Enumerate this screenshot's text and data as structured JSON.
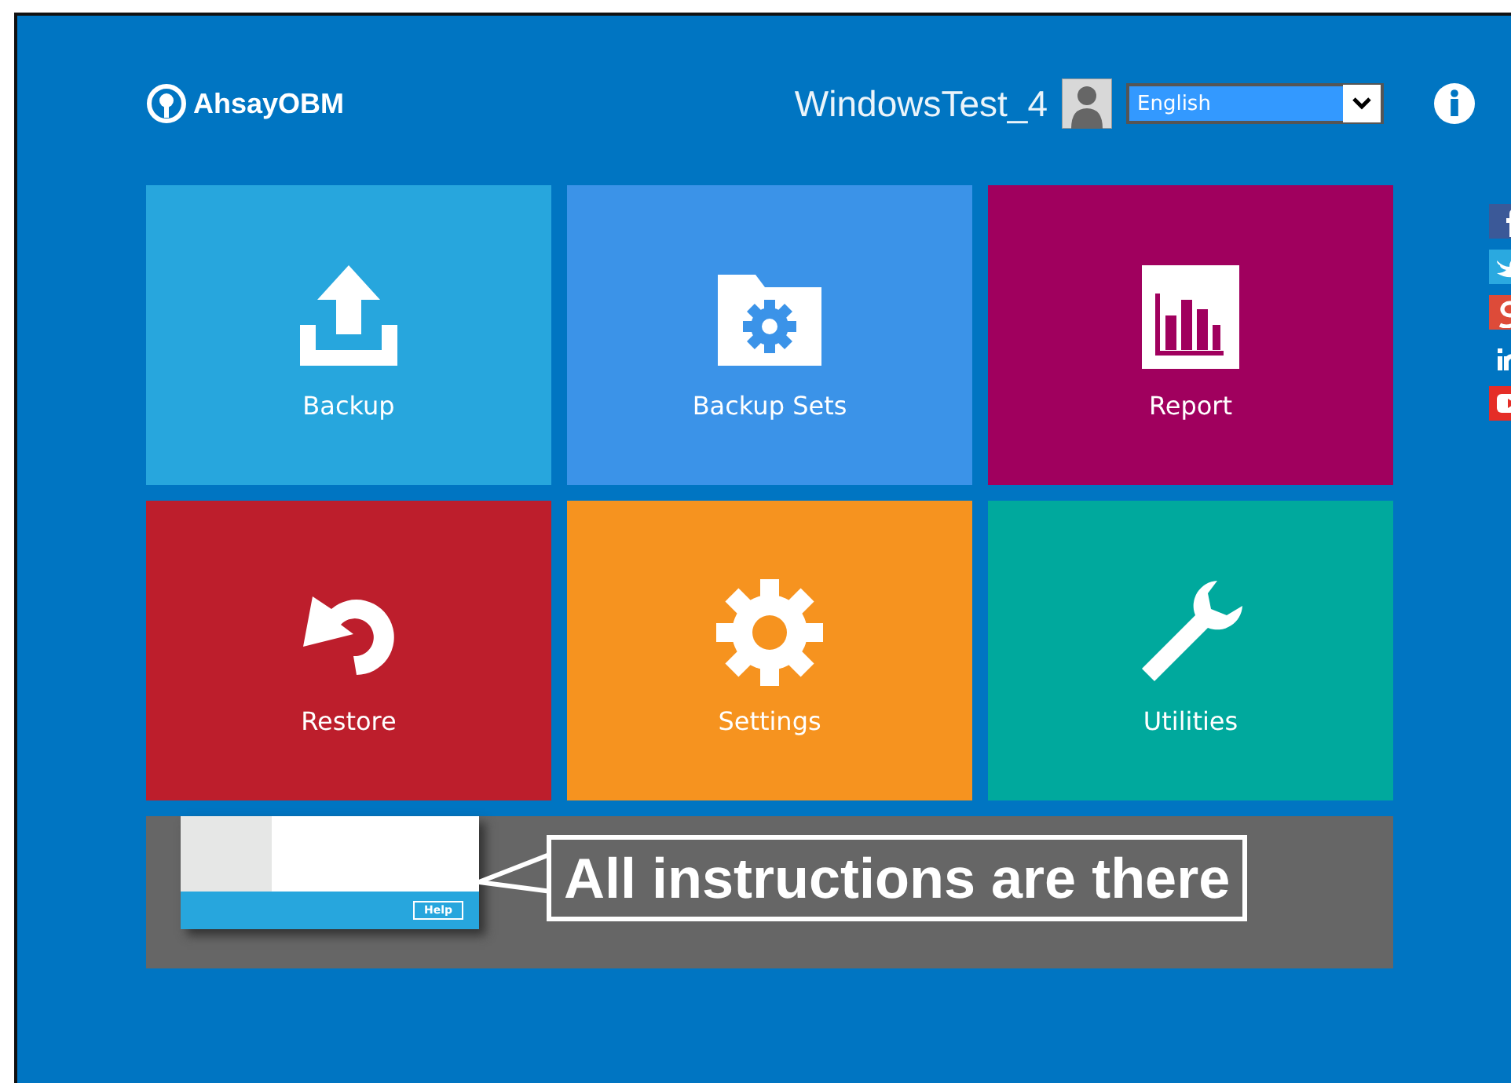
{
  "header": {
    "logo": "AhsayOBM",
    "user": "WindowsTest_4",
    "language": "English"
  },
  "tiles": [
    {
      "label": "Backup",
      "kind": "upload",
      "color": "#27a6dd"
    },
    {
      "label": "Backup Sets",
      "kind": "folder",
      "color": "#3b93e8"
    },
    {
      "label": "Report",
      "kind": "report",
      "color": "#a0005e"
    },
    {
      "label": "Restore",
      "kind": "restore",
      "color": "#bd1e2c"
    },
    {
      "label": "Settings",
      "kind": "gear",
      "color": "#f6931f"
    },
    {
      "label": "Utilities",
      "kind": "wrench",
      "color": "#00a99d"
    }
  ],
  "banner": {
    "help_button": "Help",
    "caption": "All instructions are there"
  },
  "social": [
    {
      "kind": "facebook",
      "color": "#3b5998"
    },
    {
      "kind": "twitter",
      "color": "#2aa9e0"
    },
    {
      "kind": "google",
      "color": "#dd4b39"
    },
    {
      "kind": "linkedin"
    },
    {
      "kind": "youtube",
      "color": "#e52d27"
    }
  ]
}
